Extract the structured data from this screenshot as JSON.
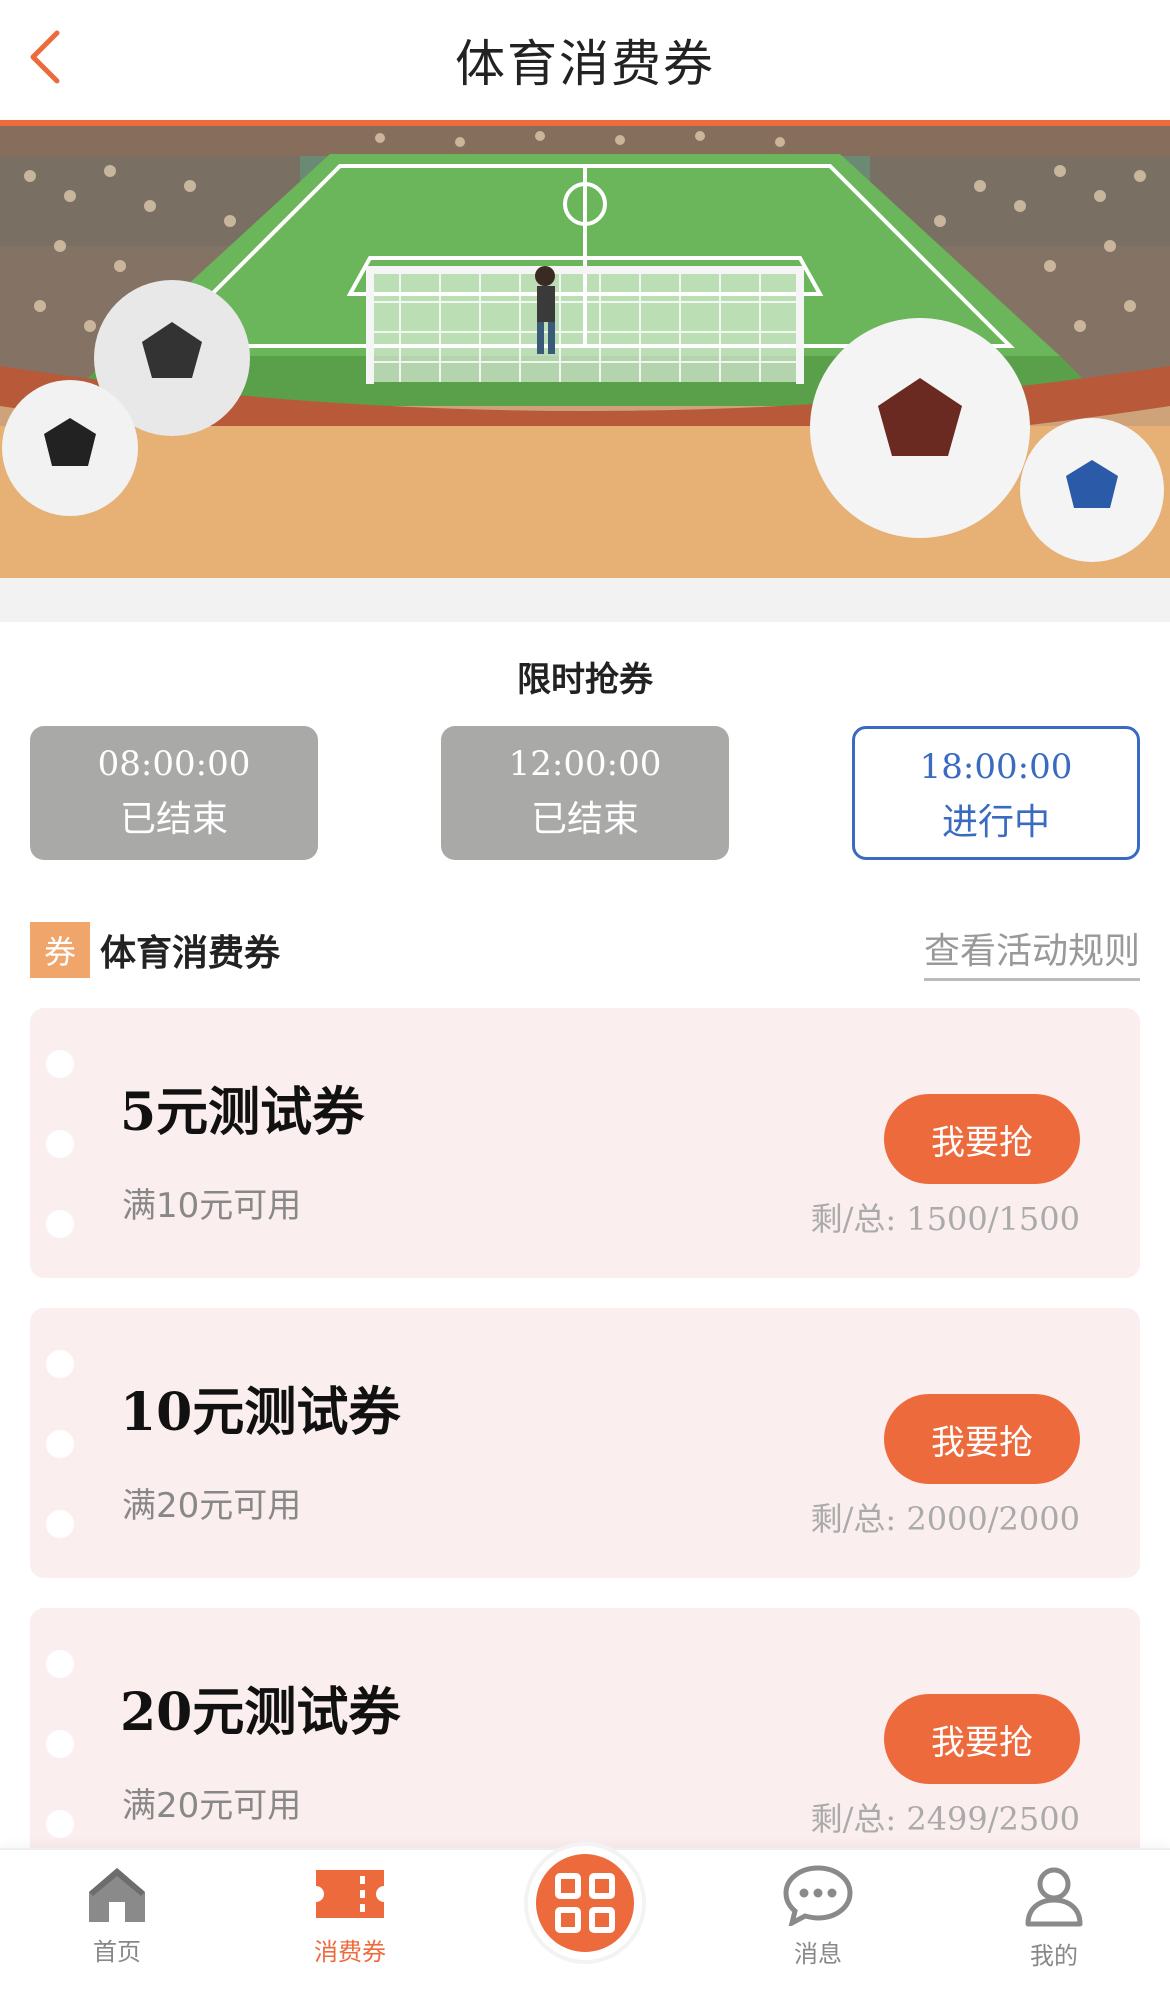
{
  "header": {
    "title": "体育消费券"
  },
  "limited": {
    "title": "限时抢券",
    "slots": [
      {
        "time": "08:00:00",
        "status": "已结束"
      },
      {
        "time": "12:00:00",
        "status": "已结束"
      },
      {
        "time": "18:00:00",
        "status": "进行中"
      }
    ]
  },
  "section": {
    "badge": "券",
    "title": "体育消费券",
    "rules_link": "查看活动规则"
  },
  "coupons": [
    {
      "title": "5元测试券",
      "condition": "满10元可用",
      "button": "我要抢",
      "remain": "剩/总: 1500/1500"
    },
    {
      "title": "10元测试券",
      "condition": "满20元可用",
      "button": "我要抢",
      "remain": "剩/总: 2000/2000"
    },
    {
      "title": "20元测试券",
      "condition": "满20元可用",
      "button": "我要抢",
      "remain": "剩/总: 2499/2500"
    }
  ],
  "nav": {
    "items": [
      {
        "label": "首页",
        "icon": "home-icon"
      },
      {
        "label": "消费券",
        "icon": "ticket-icon"
      },
      {
        "label": "",
        "icon": "qr-code-icon"
      },
      {
        "label": "消息",
        "icon": "chat-icon"
      },
      {
        "label": "我的",
        "icon": "user-icon"
      }
    ]
  },
  "colors": {
    "accent": "#ed6a3d",
    "active_slot": "#3a6bc0",
    "ended_slot": "#a9a9a8",
    "coupon_bg": "#fbeeee"
  }
}
